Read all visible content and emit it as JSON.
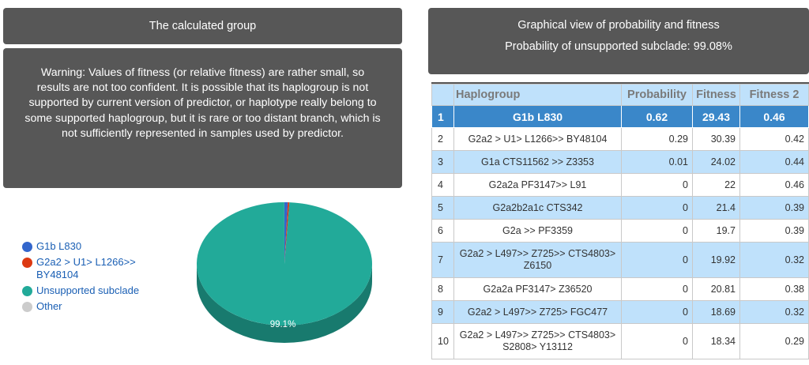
{
  "left_panel": {
    "title": "The calculated group",
    "warning": "Warning: Values of fitness (or relative fitness) are rather small, so results are not too confident. It is possible that its haplogroup is not supported by current version of predictor, or haplotype really belong to some supported haplogroup, but it is rare or too distant branch, which is not sufficiently represented in samples used by predictor."
  },
  "right_panel": {
    "title": "Graphical view of probability and fitness",
    "subtitle": "Probability of unsupported subclade: 99.08%"
  },
  "legend": [
    {
      "label": "G1b L830",
      "color": "#3366cc"
    },
    {
      "label": "G2a2 > U1> L1266>> BY48104",
      "color": "#dc3912"
    },
    {
      "label": "Unsupported subclade",
      "color": "#22aa99"
    },
    {
      "label": "Other",
      "color": "#cccccc"
    }
  ],
  "pie": {
    "slice_label": "99.1%",
    "slices": [
      {
        "name": "G1b L830",
        "value": 0.62,
        "color": "#3366cc"
      },
      {
        "name": "G2a2 > U1> L1266>> BY48104",
        "value": 0.29,
        "color": "#dc3912"
      },
      {
        "name": "Unsupported subclade",
        "value": 99.08,
        "color": "#22aa99"
      },
      {
        "name": "Other",
        "value": 0.01,
        "color": "#cccccc"
      }
    ]
  },
  "table": {
    "headers": [
      "Haplogroup",
      "Probability",
      "Fitness",
      "Fitness 2"
    ],
    "rows": [
      {
        "n": "1",
        "haplogroup": "G1b L830",
        "probability": "0.62",
        "fitness": "29.43",
        "fitness2": "0.46"
      },
      {
        "n": "2",
        "haplogroup": "G2a2 > U1> L1266>> BY48104",
        "probability": "0.29",
        "fitness": "30.39",
        "fitness2": "0.42"
      },
      {
        "n": "3",
        "haplogroup": "G1a CTS11562 >> Z3353",
        "probability": "0.01",
        "fitness": "24.02",
        "fitness2": "0.44"
      },
      {
        "n": "4",
        "haplogroup": "G2a2a PF3147>> L91",
        "probability": "0",
        "fitness": "22",
        "fitness2": "0.46"
      },
      {
        "n": "5",
        "haplogroup": "G2a2b2a1c CTS342",
        "probability": "0",
        "fitness": "21.4",
        "fitness2": "0.39"
      },
      {
        "n": "6",
        "haplogroup": "G2a >> PF3359",
        "probability": "0",
        "fitness": "19.7",
        "fitness2": "0.39"
      },
      {
        "n": "7",
        "haplogroup": "G2a2 > L497>> Z725>> CTS4803> Z6150",
        "probability": "0",
        "fitness": "19.92",
        "fitness2": "0.32"
      },
      {
        "n": "8",
        "haplogroup": "G2a2a PF3147> Z36520",
        "probability": "0",
        "fitness": "20.81",
        "fitness2": "0.38"
      },
      {
        "n": "9",
        "haplogroup": "G2a2 > L497>> Z725> FGC477",
        "probability": "0",
        "fitness": "18.69",
        "fitness2": "0.32"
      },
      {
        "n": "10",
        "haplogroup": "G2a2 > L497>> Z725>> CTS4803> S2808> Y13112",
        "probability": "0",
        "fitness": "18.34",
        "fitness2": "0.29"
      }
    ]
  }
}
